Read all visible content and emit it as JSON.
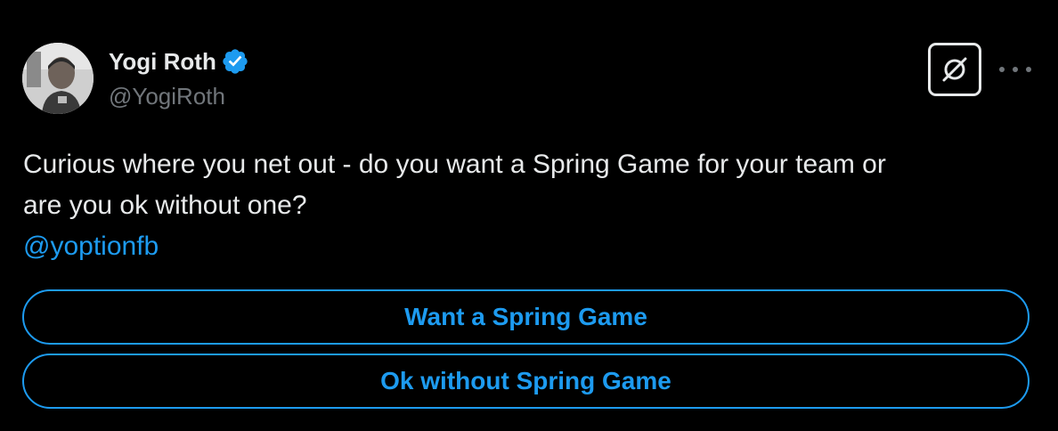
{
  "author": {
    "display_name": "Yogi Roth",
    "handle": "@YogiRoth",
    "verified": true
  },
  "tweet": {
    "text_line_1": "Curious where you net out - do you want a Spring Game for your team or",
    "text_line_2": "are you ok without one?",
    "mention": "@yoptionfb"
  },
  "poll": {
    "options": [
      {
        "label": "Want a Spring Game"
      },
      {
        "label": "Ok without Spring Game"
      }
    ]
  },
  "icons": {
    "verified": "verified-badge-icon",
    "grok": "grok-icon",
    "more": "more-options-icon"
  },
  "colors": {
    "background": "#000000",
    "text": "#e7e9ea",
    "secondary": "#71767b",
    "accent": "#1d9bf0"
  }
}
